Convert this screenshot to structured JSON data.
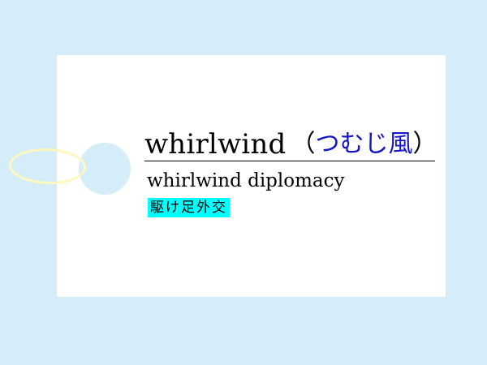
{
  "card": {
    "headword": "whirlwind",
    "reading_open": "（",
    "reading": "つむじ風",
    "reading_close": "）",
    "example_phrase": "whirlwind diplomacy",
    "example_translation": "駆け足外交"
  },
  "colors": {
    "background": "#d5edf9",
    "card": "#ffffff",
    "reading_text": "#1515c9",
    "highlight": "#00ffff",
    "tag_loop": "#fff7be"
  },
  "icons": {
    "tag_hole": "tag-hole-circle",
    "tag_loop": "tag-string-loop"
  }
}
